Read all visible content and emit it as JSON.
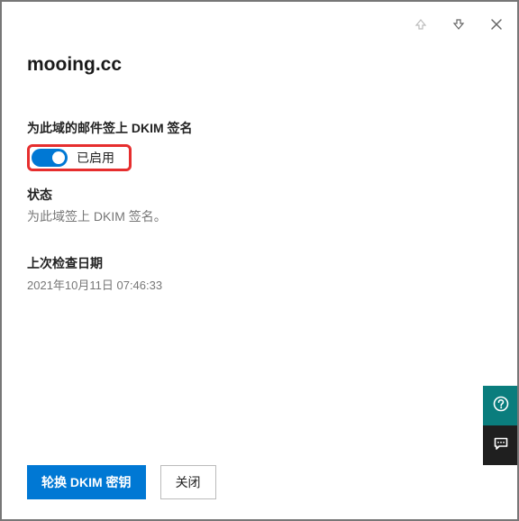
{
  "header": {
    "domain_title": "mooing.cc"
  },
  "dkim": {
    "section_label": "为此域的邮件签上 DKIM 签名",
    "toggle_enabled_label": "已启用",
    "status_label": "状态",
    "status_value": "为此域签上 DKIM 签名。",
    "last_check_label": "上次检查日期",
    "last_check_value": "2021年10月11日 07:46:33"
  },
  "footer": {
    "rotate_button": "轮换 DKIM 密钥",
    "close_button": "关闭"
  },
  "icons": {
    "prev": "arrow-up",
    "next": "arrow-down",
    "close": "close",
    "help": "help",
    "feedback": "feedback"
  }
}
